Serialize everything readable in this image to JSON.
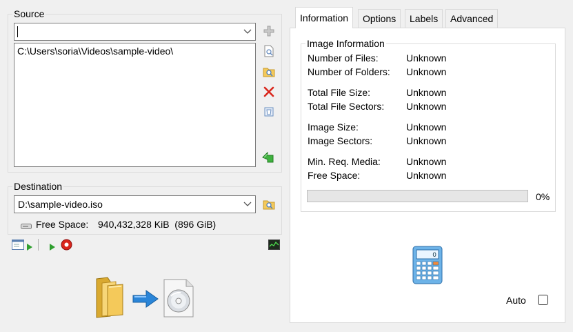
{
  "source": {
    "title": "Source",
    "input_value": "",
    "items": [
      "C:\\Users\\soria\\Videos\\sample-video\\"
    ]
  },
  "destination": {
    "title": "Destination",
    "value": "D:\\sample-video.iso",
    "free_space_label": "Free Space:",
    "free_space_value": "940,432,328 KiB  (896 GiB)"
  },
  "tabs": [
    {
      "label": "Information",
      "active": true
    },
    {
      "label": "Options",
      "active": false
    },
    {
      "label": "Labels",
      "active": false
    },
    {
      "label": "Advanced",
      "active": false
    }
  ],
  "image_info": {
    "title": "Image Information",
    "rows": [
      {
        "label": "Number of Files:",
        "value": "Unknown"
      },
      {
        "label": "Number of Folders:",
        "value": "Unknown"
      },
      {
        "label": "Total File Size:",
        "value": "Unknown"
      },
      {
        "label": "Total File Sectors:",
        "value": "Unknown"
      },
      {
        "label": "Image Size:",
        "value": "Unknown"
      },
      {
        "label": "Image Sectors:",
        "value": "Unknown"
      },
      {
        "label": "Min. Req. Media:",
        "value": "Unknown"
      },
      {
        "label": "Free Space:",
        "value": "Unknown"
      }
    ],
    "progress": 0,
    "progress_text": "0%"
  },
  "auto": {
    "label": "Auto",
    "checked": false
  },
  "icons": {
    "add": "add-icon",
    "search_file": "search-file-icon",
    "search_folder": "search-folder-icon",
    "remove": "remove-icon",
    "clear": "clear-icon",
    "go": "build-icon",
    "browse_dest": "browse-folder-icon",
    "drive": "drive-icon",
    "calculator": "calculator-icon"
  },
  "colors": {
    "accent_red": "#d9261c",
    "accent_green": "#2f8f2f",
    "accent_blue": "#2a85d8"
  }
}
